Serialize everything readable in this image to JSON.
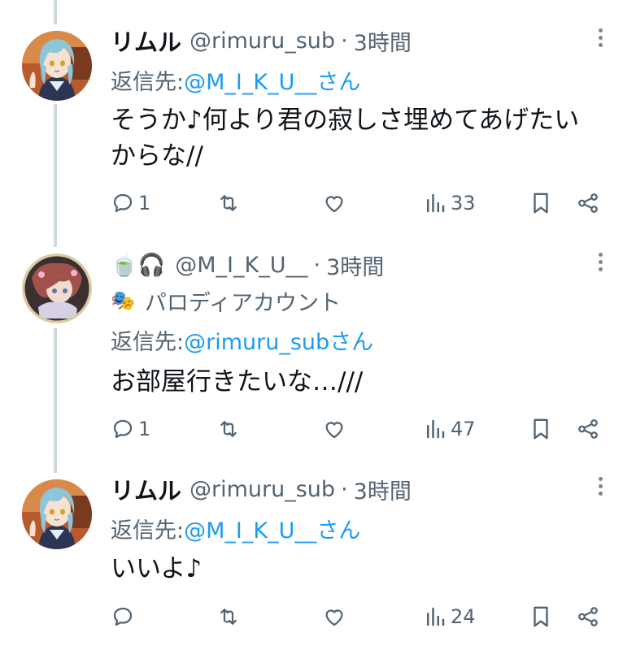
{
  "tweets": [
    {
      "display_name": "リムル",
      "handle": "@rimuru_sub",
      "dot": "·",
      "time": "3時間",
      "reply_prefix": "返信先: ",
      "reply_target": "@M_I_K_U__さん",
      "text_line1": "そうか♪何より君の寂しさ埋めてあげたい",
      "text_line2": "からな//",
      "replies": "1",
      "views": "33"
    },
    {
      "emoji": "🍵🎧",
      "handle": "@M_I_K_U__",
      "dot": "·",
      "time": "3時間",
      "label_icon": "🎭",
      "label": "パロディアカウント",
      "reply_prefix": "返信先: ",
      "reply_target": "@rimuru_subさん",
      "text_line1": "お部屋行きたいな…///",
      "replies": "1",
      "views": "47"
    },
    {
      "display_name": "リムル",
      "handle": "@rimuru_sub",
      "dot": "·",
      "time": "3時間",
      "reply_prefix": "返信先: ",
      "reply_target": "@M_I_K_U__さん",
      "text_line1": "いいよ♪",
      "replies": "",
      "views": "24"
    }
  ],
  "colors": {
    "link": "#1d9bf0",
    "secondary": "#536471",
    "primary": "#0f1419",
    "thread_line": "#cfd9de"
  },
  "icons": [
    "reply-icon",
    "retweet-icon",
    "like-icon",
    "views-icon",
    "bookmark-icon",
    "share-icon",
    "more-icon"
  ]
}
